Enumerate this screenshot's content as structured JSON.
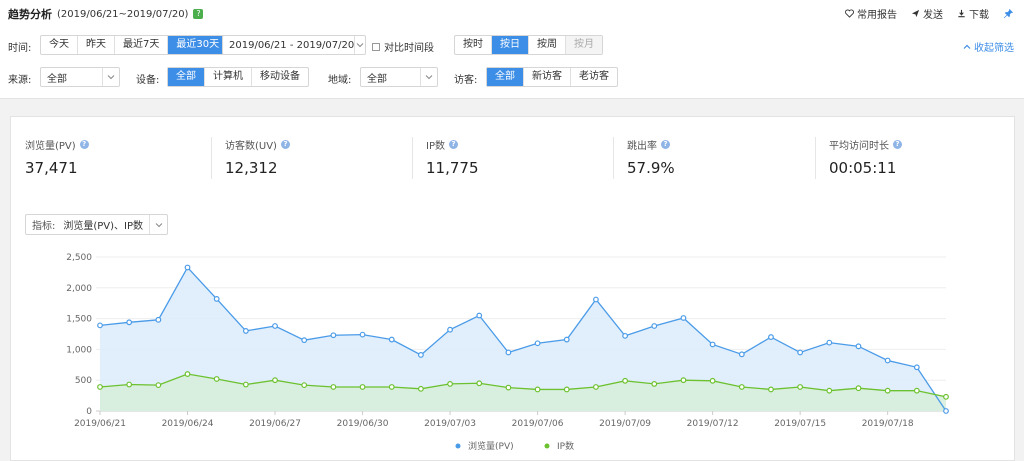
{
  "header": {
    "title": "趋势分析",
    "date_range": "(2019/06/21~2019/07/20)",
    "badge": "?",
    "actions": {
      "report": "常用报告",
      "send": "发送",
      "download": "下载"
    }
  },
  "filters": {
    "time_label": "时间:",
    "time_options": [
      "今天",
      "昨天",
      "最近7天",
      "最近30天"
    ],
    "time_active": 3,
    "date_range_value": "2019/06/21 - 2019/07/20",
    "compare_label": "对比时间段",
    "granularity_options": [
      "按时",
      "按日",
      "按周",
      "按月"
    ],
    "granularity_active": 1,
    "collapse_label": "收起筛选",
    "source_label": "来源:",
    "source_value": "全部",
    "device_label": "设备:",
    "device_options": [
      "全部",
      "计算机",
      "移动设备"
    ],
    "region_label": "地域:",
    "region_value": "全部",
    "visitor_label": "访客:",
    "visitor_options": [
      "全部",
      "新访客",
      "老访客"
    ]
  },
  "metrics": [
    {
      "label": "浏览量(PV)",
      "value": "37,471"
    },
    {
      "label": "访客数(UV)",
      "value": "12,312"
    },
    {
      "label": "IP数",
      "value": "11,775"
    },
    {
      "label": "跳出率",
      "value": "57.9%"
    },
    {
      "label": "平均访问时长",
      "value": "00:05:11"
    }
  ],
  "indicator": {
    "label": "指标:",
    "value": "浏览量(PV)、IP数"
  },
  "colors": {
    "accent": "#3d8ee6",
    "pv": "#4a9be8",
    "pv_fill": "#dcebfa",
    "ip": "#6cc12e",
    "ip_fill": "#d7eedd"
  },
  "chart_data": {
    "type": "area",
    "x": [
      "2019/06/21",
      "2019/06/22",
      "2019/06/23",
      "2019/06/24",
      "2019/06/25",
      "2019/06/26",
      "2019/06/27",
      "2019/06/28",
      "2019/06/29",
      "2019/06/30",
      "2019/07/01",
      "2019/07/02",
      "2019/07/03",
      "2019/07/04",
      "2019/07/05",
      "2019/07/06",
      "2019/07/07",
      "2019/07/08",
      "2019/07/09",
      "2019/07/10",
      "2019/07/11",
      "2019/07/12",
      "2019/07/13",
      "2019/07/14",
      "2019/07/15",
      "2019/07/16",
      "2019/07/17",
      "2019/07/18",
      "2019/07/19",
      "2019/07/20"
    ],
    "x_tick_labels": [
      "2019/06/21",
      "2019/06/24",
      "2019/06/27",
      "2019/06/30",
      "2019/07/03",
      "2019/07/06",
      "2019/07/09",
      "2019/07/12",
      "2019/07/15",
      "2019/07/18"
    ],
    "y_ticks": [
      "0",
      "500",
      "1,000",
      "1,500",
      "2,000",
      "2,500"
    ],
    "ylim": [
      0,
      2500
    ],
    "series": [
      {
        "name": "浏览量(PV)",
        "values": [
          1390,
          1440,
          1480,
          2330,
          1820,
          1300,
          1380,
          1150,
          1230,
          1240,
          1160,
          910,
          1320,
          1550,
          950,
          1100,
          1160,
          1810,
          1220,
          1380,
          1510,
          1080,
          920,
          1200,
          950,
          1110,
          1050,
          820,
          710,
          0
        ]
      },
      {
        "name": "IP数",
        "values": [
          390,
          430,
          420,
          600,
          520,
          430,
          500,
          420,
          390,
          390,
          390,
          360,
          440,
          450,
          380,
          350,
          350,
          390,
          490,
          440,
          500,
          490,
          390,
          350,
          390,
          330,
          370,
          330,
          330,
          230
        ]
      }
    ],
    "grid": true,
    "legend": "bottom-center"
  }
}
